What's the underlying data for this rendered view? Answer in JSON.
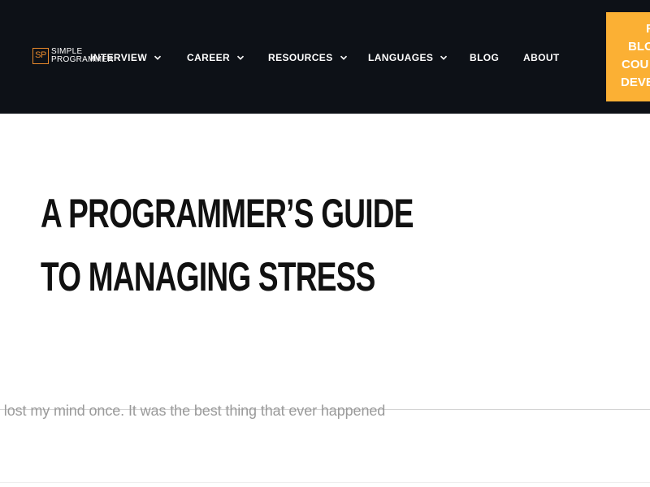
{
  "header": {
    "logo": {
      "mark": "SP",
      "line1": "SIMPLE",
      "line2": "PROGRAMMER"
    },
    "nav": [
      {
        "label": "INTERVIEW",
        "has_dropdown": true,
        "icon": "chevron-down-icon"
      },
      {
        "label": "CAREER",
        "has_dropdown": true,
        "icon": "chevron-down-icon"
      },
      {
        "label": "RESOURCES",
        "has_dropdown": true,
        "icon": "chevron-down-icon"
      },
      {
        "label": "LANGUAGES",
        "has_dropdown": true,
        "icon": "chevron-down-icon"
      },
      {
        "label": "BLOG",
        "has_dropdown": false
      },
      {
        "label": "ABOUT",
        "has_dropdown": false
      }
    ],
    "cta": {
      "lines": [
        "F",
        "BLO",
        "COU",
        "DEVE"
      ]
    }
  },
  "article": {
    "title_lines": [
      "A PROGRAMMER’S GUIDE",
      "TO MANAGING STRESS"
    ],
    "intro": "I lost my mind once. It was the best thing that ever happened"
  },
  "colors": {
    "header_bg": "#0d1117",
    "accent": "#e8892b",
    "cta_bg": "#fbb034",
    "title": "#111111",
    "intro_text": "#9a9a9a"
  }
}
